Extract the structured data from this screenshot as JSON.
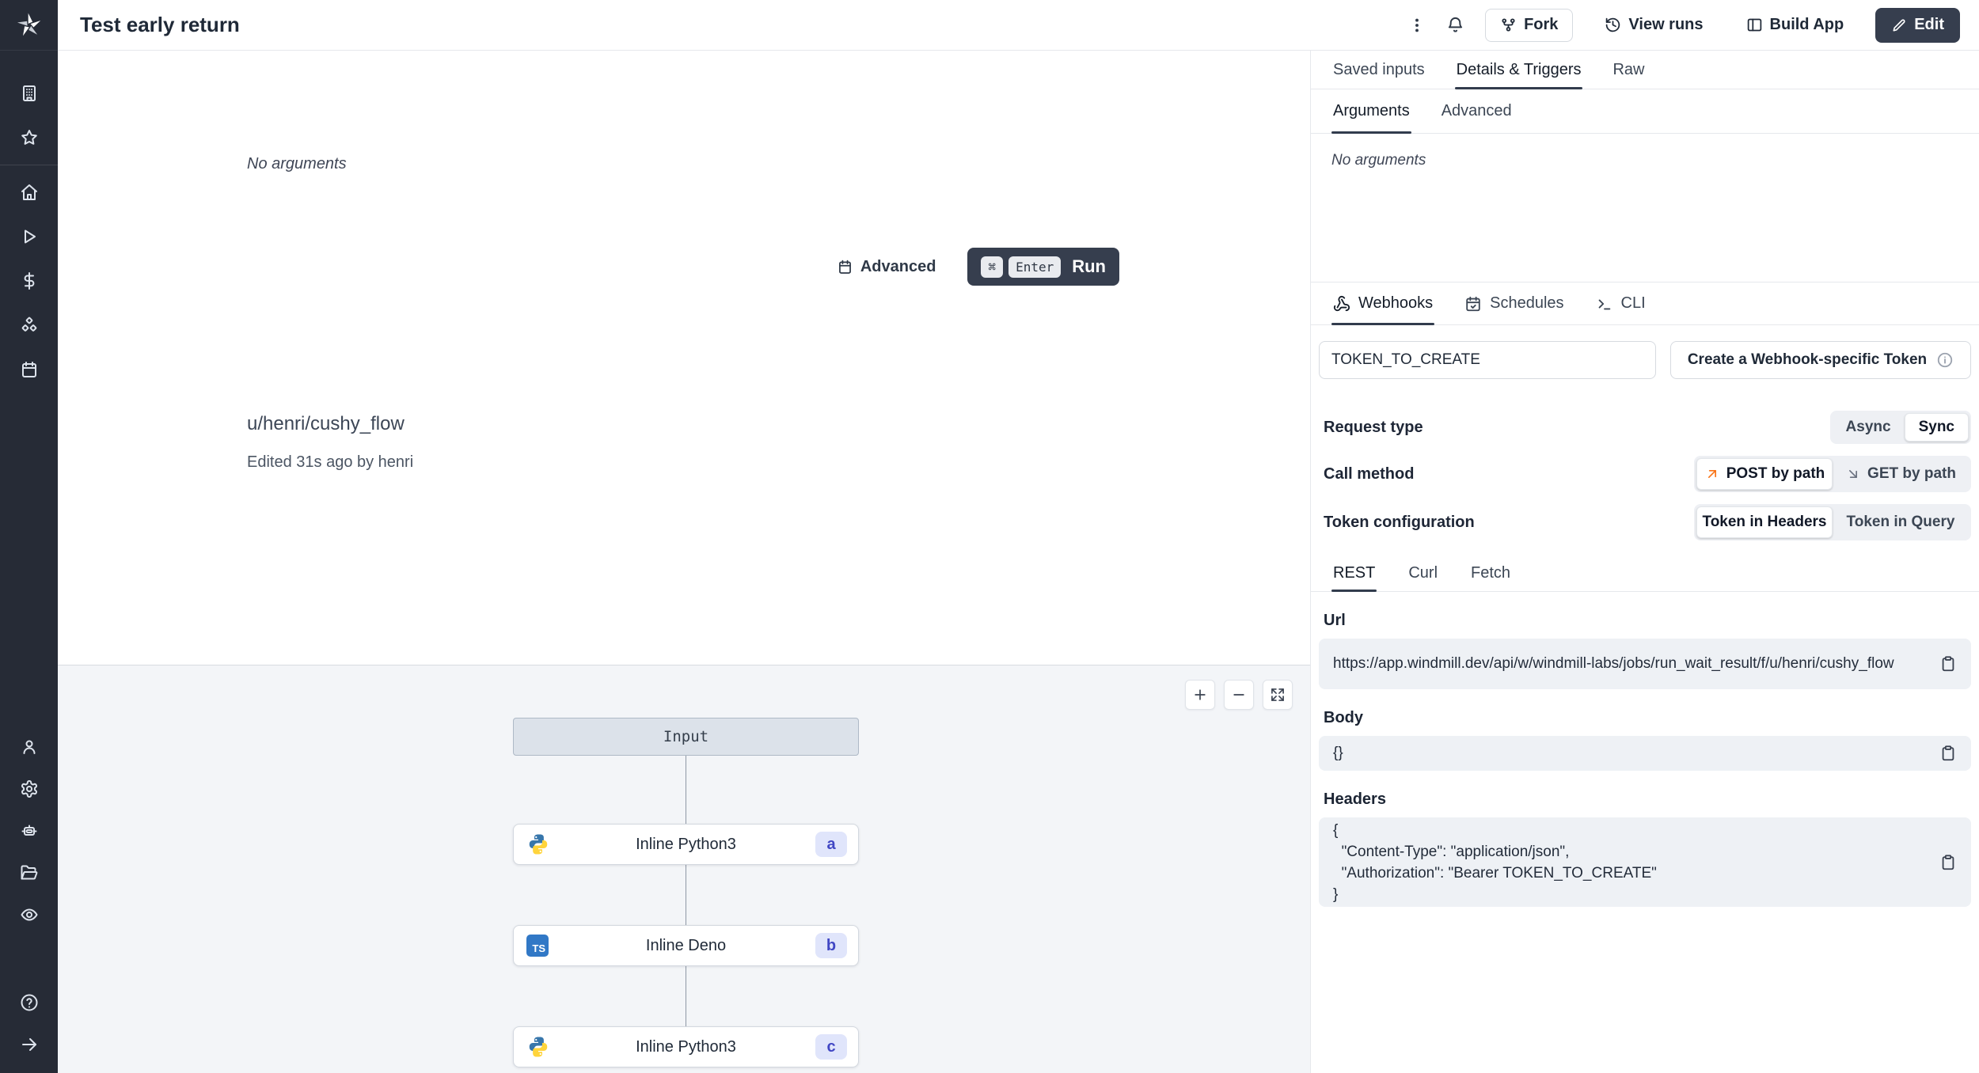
{
  "topbar": {
    "title": "Test early return",
    "fork_label": "Fork",
    "view_runs_label": "View runs",
    "build_app_label": "Build App",
    "edit_label": "Edit"
  },
  "sidebar": {
    "icons": [
      "windmill-logo",
      "workspace",
      "favorites",
      "home",
      "runs",
      "variables",
      "resources",
      "schedules",
      "users",
      "settings",
      "workers",
      "folders",
      "audit-logs",
      "help",
      "collapse"
    ]
  },
  "run_panel": {
    "no_arguments": "No arguments",
    "advanced_label": "Advanced",
    "kbd_cmd": "⌘",
    "kbd_enter": "Enter",
    "run_label": "Run",
    "flow_path": "u/henri/cushy_flow",
    "edited_info": "Edited 31s ago by henri"
  },
  "graph": {
    "input_label": "Input",
    "nodes": [
      {
        "title": "Inline Python3",
        "badge": "a",
        "lang": "python"
      },
      {
        "title": "Inline Deno",
        "badge": "b",
        "lang": "typescript"
      },
      {
        "title": "Inline Python3",
        "badge": "c",
        "lang": "python"
      }
    ],
    "ts_icon_label": "TS",
    "controls": [
      "zoom-in",
      "zoom-out",
      "fullscreen"
    ]
  },
  "details_panel": {
    "tabs": [
      "Saved inputs",
      "Details & Triggers",
      "Raw"
    ],
    "active_tab": "Details & Triggers",
    "subtabs": [
      "Arguments",
      "Advanced"
    ],
    "active_subtab": "Arguments",
    "no_arguments": "No arguments",
    "trigger_tabs": [
      "Webhooks",
      "Schedules",
      "CLI"
    ],
    "active_trigger_tab": "Webhooks",
    "token_input_value": "TOKEN_TO_CREATE",
    "create_token_label": "Create a Webhook-specific Token",
    "request_type": {
      "label": "Request type",
      "options": [
        "Async",
        "Sync"
      ],
      "selected": "Sync"
    },
    "call_method": {
      "label": "Call method",
      "options": [
        "POST by path",
        "GET by path"
      ],
      "selected": "POST by path"
    },
    "token_configuration": {
      "label": "Token configuration",
      "options": [
        "Token in Headers",
        "Token in Query"
      ],
      "selected": "Token in Headers"
    },
    "code_tabs": [
      "REST",
      "Curl",
      "Fetch"
    ],
    "active_code_tab": "REST",
    "url_label": "Url",
    "url_value": "https://app.windmill.dev/api/w/windmill-labs/jobs/run_wait_result/f/u/henri/cushy_flow",
    "body_label": "Body",
    "body_value": "{}",
    "headers_label": "Headers",
    "headers_value": "{\n  \"Content-Type\": \"application/json\",\n  \"Authorization\": \"Bearer TOKEN_TO_CREATE\"\n}"
  },
  "colors": {
    "sidebar_bg": "#262b36",
    "dark_button_bg": "#363e4e",
    "accent_badge_bg": "#e0e5fb",
    "accent_badge_text": "#4147c4",
    "post_arrow_orange": "#f97316",
    "graph_bg": "#f3f5f8",
    "python_blue": "#3776ab",
    "python_yellow": "#ffd43b",
    "typescript_blue": "#3178c6"
  }
}
